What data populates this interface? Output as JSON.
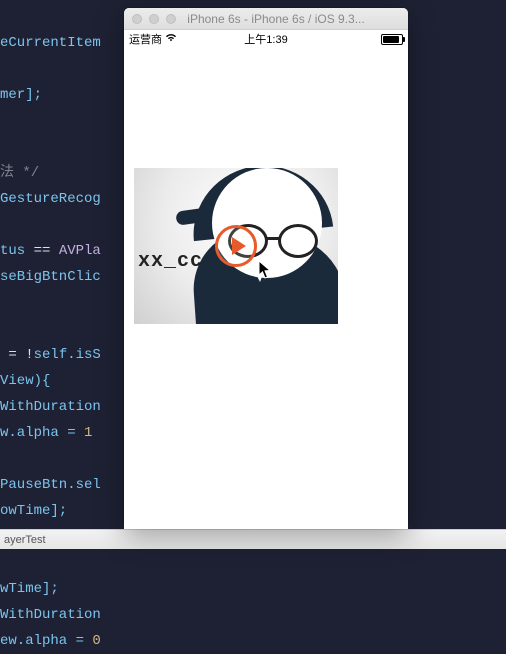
{
  "code": {
    "line1_a": "eCurrentItem",
    "line1_z": "Item];",
    "line2": "mer];",
    "line3_a": "法",
    "line3_b": " */",
    "line4": "GestureRecog",
    "line5_a": "tus",
    "line5_b": " == ",
    "line5_c": "AVPla",
    "line6": "seBigBtnClic",
    "line7_a": " = !",
    "line7_b": "self",
    "line7_c": ".isS",
    "line8": "View){",
    "line9": "WithDuration",
    "line10_a": "w.alpha = ",
    "line10_b": "1",
    "line11_a": "PauseBtn.",
    "line11_b": "sel",
    "line12": "owTime];",
    "line13": "wTime];",
    "line14": "WithDuration",
    "line15_a": "ew.alpha = ",
    "line15_b": "0"
  },
  "crumb": "ayerTest",
  "sim": {
    "title": "iPhone 6s - iPhone 6s / iOS 9.3..."
  },
  "ios": {
    "carrier": "运营商",
    "time": "上午1:39"
  },
  "poster": {
    "handle": "xx_cc"
  }
}
